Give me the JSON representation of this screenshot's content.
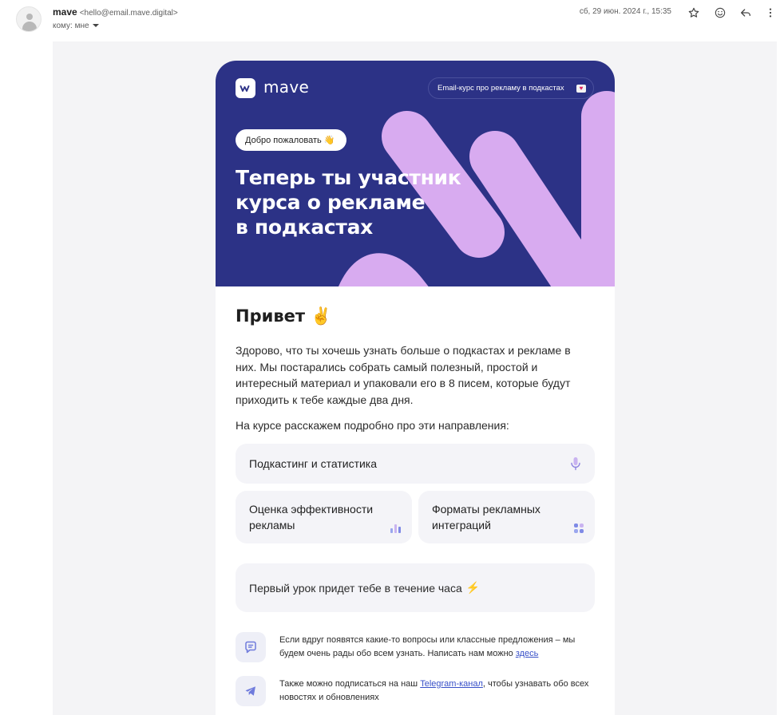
{
  "header": {
    "sender_name": "mave",
    "sender_email": "<hello@email.mave.digital>",
    "to_label": "кому: мне",
    "date": "сб, 29 июн. 2024 г., 15:35"
  },
  "icons": {
    "star": "star-icon",
    "emoji": "emoji-icon",
    "reply": "reply-icon",
    "more": "more-vert-icon"
  },
  "hero": {
    "logo_text": "mave",
    "course_badge": "Email-курс про рекламу в подкастах",
    "welcome_badge": "Добро пожаловать 👋",
    "title_line1": "Теперь ты участник",
    "title_line2": "курса о рекламе",
    "title_line3": "в подкастах",
    "colors": {
      "background": "#2c3286",
      "accent": "#d8abf0"
    }
  },
  "content": {
    "greeting": "Привет ✌️",
    "intro": "Здорово, что ты хочешь узнать больше о подкастах и рекламе в них. Мы постарались собрать самый полезный, простой и интересный материал и упаковали его в 8 писем, которые будут приходить к тебе каждые два дня.",
    "directions_label": "На курсе расскажем подробно про эти направления:",
    "topics": [
      {
        "line1": "Подкастинг и статистика",
        "line2": "",
        "icon": "microphone-icon"
      },
      {
        "line1": "Оценка эффективности",
        "line2": "рекламы",
        "icon": "bar-chart-icon"
      },
      {
        "line1": "Форматы рекламных",
        "line2": "интеграций",
        "icon": "grid-icon"
      }
    ],
    "notice": "Первый урок придет тебе в течение часа",
    "notice_icon": "⚡",
    "contact_text": "Если вдруг появятся какие-то вопросы или классные предложения – мы будем очень рады обо всем узнать. Написать нам можно",
    "contact_link": "здесь",
    "telegram_text_before": "Также можно подписаться на наш",
    "telegram_link": "Telegram-канал",
    "telegram_text_after": ", чтобы узнавать обо всех новостях и обновлениях"
  }
}
